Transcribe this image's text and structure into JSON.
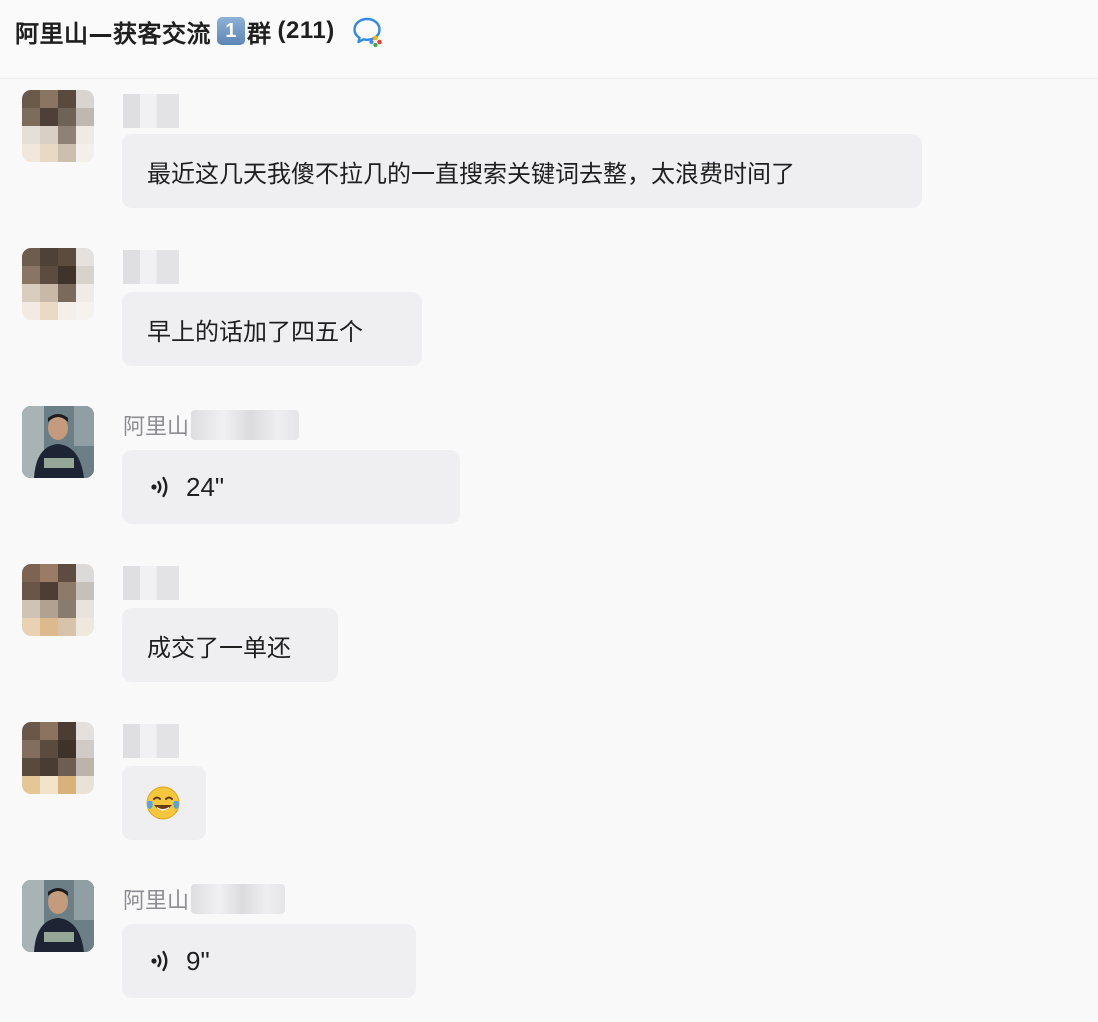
{
  "header": {
    "title": "阿里山—获客交流",
    "badge": "1",
    "suffix": "群",
    "count": "(211)",
    "icon": "wecom-chat-icon"
  },
  "messages": [
    {
      "sender": "",
      "type": "text",
      "text": "最近这几天我傻不拉几的一直搜索关键词去整，太浪费时间了"
    },
    {
      "sender": "",
      "type": "text",
      "text": "早上的话加了四五个"
    },
    {
      "sender": "阿里山",
      "type": "voice",
      "duration": "24\"",
      "icon": "voice-icon"
    },
    {
      "sender": "",
      "type": "text",
      "text": "成交了一单还"
    },
    {
      "sender": "",
      "type": "emoji",
      "icon": "crying-laughing-emoji-icon"
    },
    {
      "sender": "阿里山",
      "type": "voice",
      "duration": "9\"",
      "icon": "voice-icon"
    }
  ],
  "colors": {
    "bubble": "#efeff2",
    "background": "#f9f9fa",
    "sender": "#8d8d93"
  }
}
